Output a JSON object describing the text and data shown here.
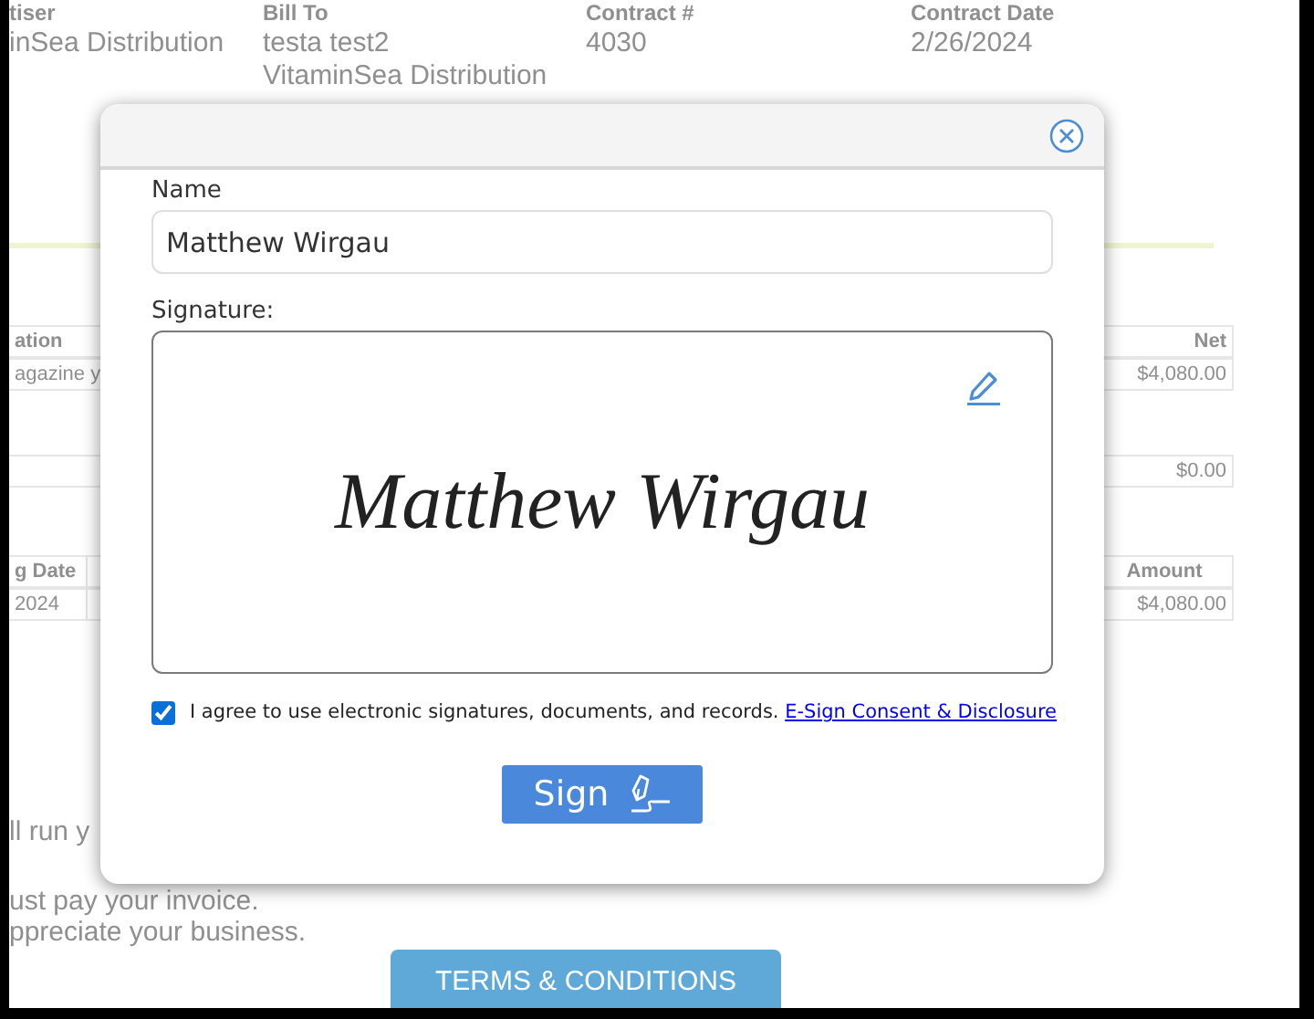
{
  "background_page": {
    "header_labels": [
      "tiser",
      "Bill To",
      "Contract #",
      "Contract Date"
    ],
    "advertiser": "inSea Distribution",
    "bill_to": [
      "testa test2",
      "VitaminSea Distribution"
    ],
    "contract_number": "4030",
    "contract_date": "2/26/2024",
    "left_table": {
      "header": "ation",
      "cell": "agazine y"
    },
    "right_table": {
      "header": "Net",
      "cell": "$4,080.00",
      "total": "$0.00"
    },
    "payment_table": {
      "left_header": "g Date",
      "left_cell": "2024",
      "right_header": "Amount",
      "right_cell": "$4,080.00"
    },
    "notes": [
      "ll run y",
      "ust pay your invoice.",
      "ppreciate your business."
    ],
    "terms_button": "TERMS & CONDITIONS"
  },
  "dialog": {
    "name_label": "Name",
    "name_value": "Matthew Wirgau",
    "signature_label": "Signature:",
    "signature_text": "Matthew Wirgau",
    "consent": {
      "checked": true,
      "text": "I agree to use electronic signatures, documents, and records.",
      "link": "E-Sign Consent & Disclosure"
    },
    "sign_button": "Sign"
  }
}
